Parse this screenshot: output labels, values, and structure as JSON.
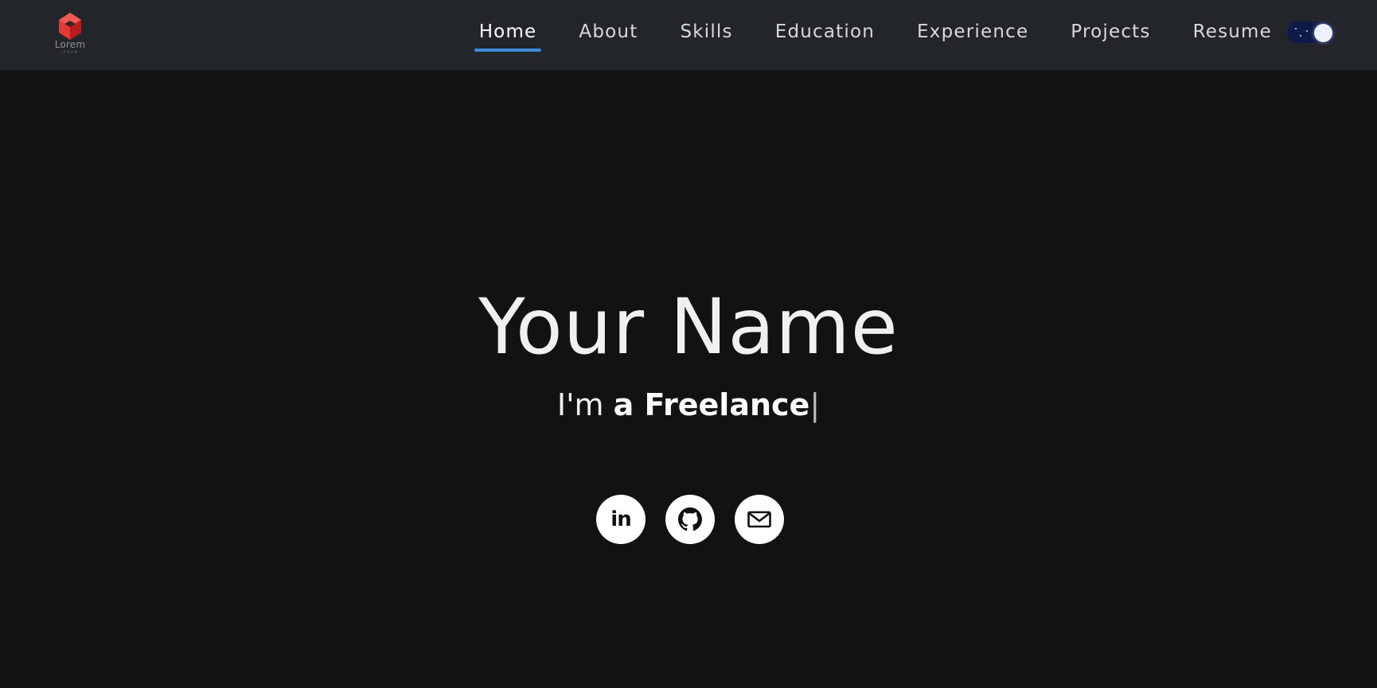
{
  "brand": {
    "logo_text": "Lorem",
    "logo_subtext": "IPSUM",
    "logo_icon": "logo-cube-icon",
    "logo_color": "#e53935"
  },
  "nav": {
    "items": [
      {
        "label": "Home",
        "active": true
      },
      {
        "label": "About"
      },
      {
        "label": "Skills"
      },
      {
        "label": "Education"
      },
      {
        "label": "Experience"
      },
      {
        "label": "Projects"
      },
      {
        "label": "Resume"
      }
    ],
    "accent_color": "#3d8bd6",
    "theme_toggle": {
      "state": "dark",
      "icon": "moon-toggle-icon"
    }
  },
  "hero": {
    "name": "Your Name",
    "tagline_prefix": "I'm ",
    "tagline_bold": "a Freelance",
    "cursor": "|"
  },
  "socials": [
    {
      "name": "linkedin",
      "icon": "linkedin-icon",
      "glyph": "in"
    },
    {
      "name": "github",
      "icon": "github-icon"
    },
    {
      "name": "email",
      "icon": "mail-icon"
    }
  ],
  "colors": {
    "navbar_bg": "#22252a",
    "page_bg": "#121212",
    "text": "#f0f0f0"
  }
}
